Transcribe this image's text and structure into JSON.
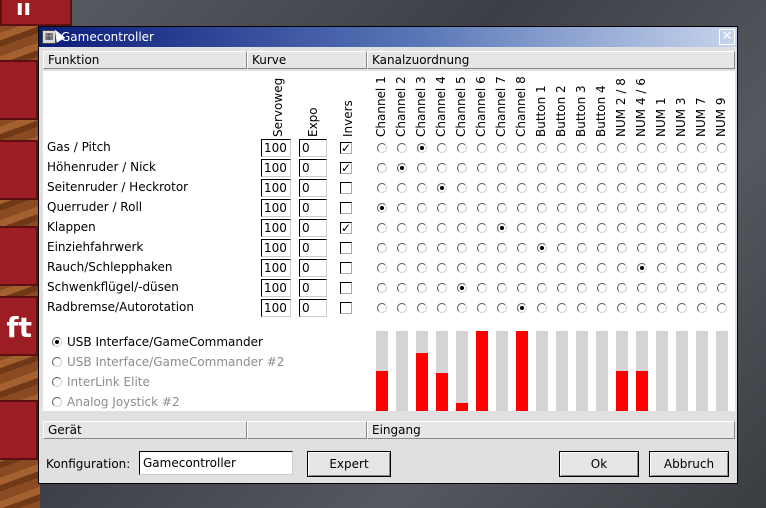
{
  "window": {
    "title": "Gamecontroller"
  },
  "headers": {
    "funktion": "Funktion",
    "kurve": "Kurve",
    "kanalzuordnung": "Kanalzuordnung",
    "geraet": "Gerät",
    "eingang": "Eingang"
  },
  "columns": {
    "servoweg": "Servoweg",
    "expo": "Expo",
    "invers": "Invers"
  },
  "channels": [
    "Channel 1",
    "Channel 2",
    "Channel 3",
    "Channel 4",
    "Channel 5",
    "Channel 6",
    "Channel 7",
    "Channel 8",
    "Button 1",
    "Button 2",
    "Button 3",
    "Button 4",
    "NUM 2 / 8",
    "NUM 4 / 6",
    "NUM 1",
    "NUM 3",
    "NUM 7",
    "NUM 9"
  ],
  "rows": [
    {
      "label": "Gas / Pitch",
      "servoweg": "100",
      "expo": "0",
      "invers": true,
      "assigned": 2
    },
    {
      "label": "Höhenruder / Nick",
      "servoweg": "100",
      "expo": "0",
      "invers": true,
      "assigned": 1
    },
    {
      "label": "Seitenruder / Heckrotor",
      "servoweg": "100",
      "expo": "0",
      "invers": false,
      "assigned": 3
    },
    {
      "label": "Querruder / Roll",
      "servoweg": "100",
      "expo": "0",
      "invers": false,
      "assigned": 0
    },
    {
      "label": "Klappen",
      "servoweg": "100",
      "expo": "0",
      "invers": true,
      "assigned": 6
    },
    {
      "label": "Einziehfahrwerk",
      "servoweg": "100",
      "expo": "0",
      "invers": false,
      "assigned": 8
    },
    {
      "label": "Rauch/Schlepphaken",
      "servoweg": "100",
      "expo": "0",
      "invers": false,
      "assigned": 13
    },
    {
      "label": "Schwenkflügel/-düsen",
      "servoweg": "100",
      "expo": "0",
      "invers": false,
      "assigned": 4
    },
    {
      "label": "Radbremse/Autorotation",
      "servoweg": "100",
      "expo": "0",
      "invers": false,
      "assigned": 7
    }
  ],
  "devices": [
    {
      "label": "USB Interface/GameCommander",
      "selected": true,
      "enabled": true
    },
    {
      "label": "USB Interface/GameCommander #2",
      "selected": false,
      "enabled": false
    },
    {
      "label": "InterLink Elite",
      "selected": false,
      "enabled": false
    },
    {
      "label": "Analog Joystick #2",
      "selected": false,
      "enabled": false
    }
  ],
  "input_levels": [
    0.5,
    0,
    0.72,
    0.47,
    0.1,
    1.0,
    0,
    1.0,
    0,
    0,
    0,
    0,
    0.5,
    0.5,
    0,
    0,
    0,
    0
  ],
  "colors": {
    "level_fill": "#ff0000",
    "level_track": "#d4d4d4",
    "titlebar": "#0a1c7a"
  },
  "footer": {
    "konfiguration_label": "Konfiguration:",
    "konfiguration_value": "Gamecontroller",
    "expert_label": "Expert",
    "ok_label": "Ok",
    "abbruch_label": "Abbruch"
  },
  "icons": {
    "app": "gamecontroller-icon",
    "close": "close-icon"
  }
}
